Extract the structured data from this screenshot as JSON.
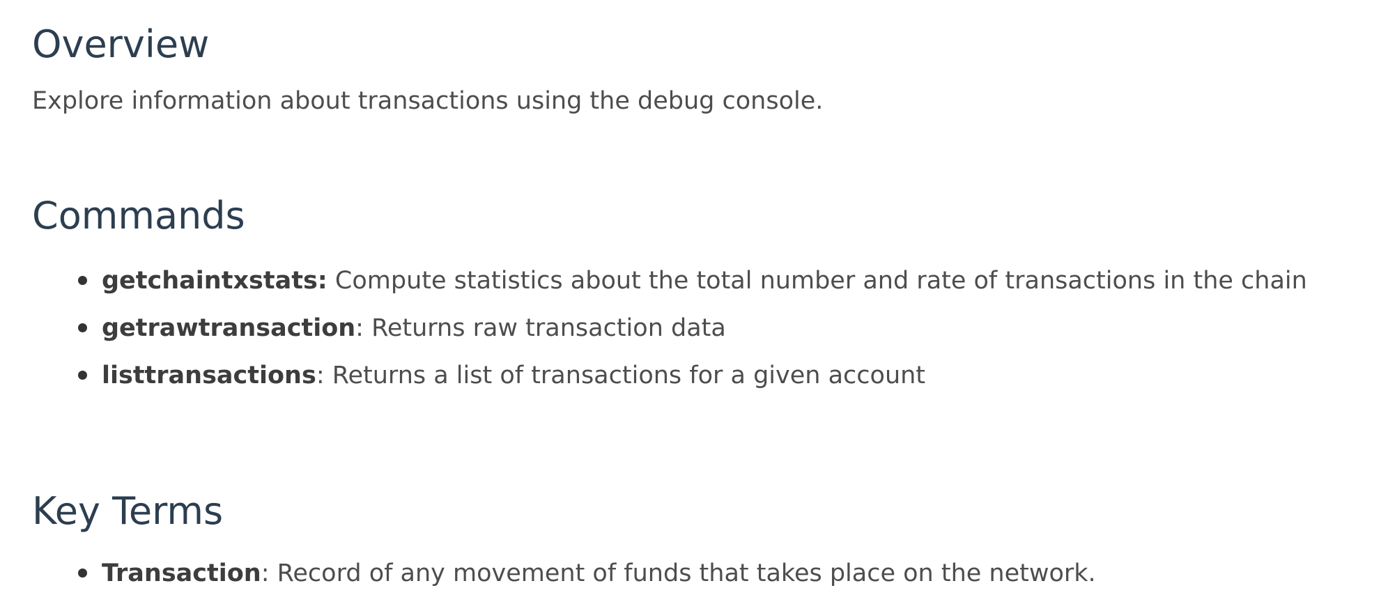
{
  "overview": {
    "heading": "Overview",
    "text": "Explore information about transactions using the debug console."
  },
  "commands": {
    "heading": "Commands",
    "items": [
      {
        "term": "getchaintxstats:",
        "desc": " Compute statistics about the total number and rate of transactions in the chain"
      },
      {
        "term": "getrawtransaction",
        "desc": ": Returns raw transaction data"
      },
      {
        "term": "listtransactions",
        "desc": ": Returns a list of transactions for a given account"
      }
    ]
  },
  "key_terms": {
    "heading": "Key Terms",
    "items": [
      {
        "term": "Transaction",
        "desc": ": Record of any movement of funds that takes place on the network."
      }
    ]
  }
}
